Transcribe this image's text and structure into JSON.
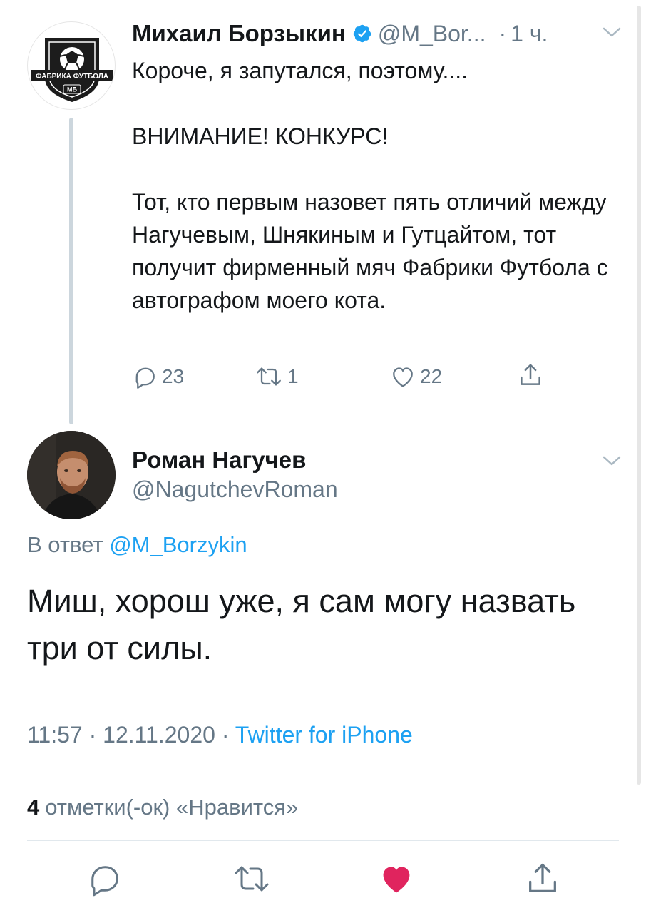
{
  "parent_tweet": {
    "author_name": "Михаил Борзыкин",
    "author_handle": "@M_Bor...",
    "separator": "·",
    "time": "1 ч.",
    "avatar_logo_text": "ФАБРИКА ФУТБОЛА",
    "avatar_logo_sub": "МБ",
    "text": {
      "line1": "Короче, я запутался, поэтому....",
      "line2": "ВНИМАНИЕ! КОНКУРС!",
      "line3": "Тот, кто первым назовет пять отличий между Нагучевым, Шнякиным и Гутцайтом, тот получит фирменный мяч Фабрики Футбола с автографом моего кота."
    },
    "replies": "23",
    "retweets": "1",
    "likes": "22",
    "icons": {
      "verified": "verified-badge-icon",
      "reply": "reply-icon",
      "retweet": "retweet-icon",
      "like": "heart-outline-icon",
      "share": "share-icon",
      "more": "chevron-down-icon"
    }
  },
  "main_tweet": {
    "author_name": "Роман Нагучев",
    "author_handle": "@NagutchevRoman",
    "reply_prefix": "В ответ",
    "reply_mention": "@M_Borzykin",
    "text": "Миш, хорош уже, я сам могу назвать три от силы.",
    "time": "11:57",
    "date": "12.11.2020",
    "separator": "·",
    "source": "Twitter for iPhone",
    "likes_count": "4",
    "likes_label": "отметки(-ок) «Нравится»",
    "liked": true,
    "icons": {
      "reply": "reply-icon",
      "retweet": "retweet-icon",
      "like": "heart-filled-icon",
      "share": "share-icon",
      "more": "chevron-down-icon"
    }
  },
  "colors": {
    "text_primary": "#14171a",
    "text_secondary": "#657786",
    "link": "#1da1f2",
    "verified": "#1da1f2",
    "like_active": "#e0245e",
    "divider": "#e1e8ed"
  }
}
